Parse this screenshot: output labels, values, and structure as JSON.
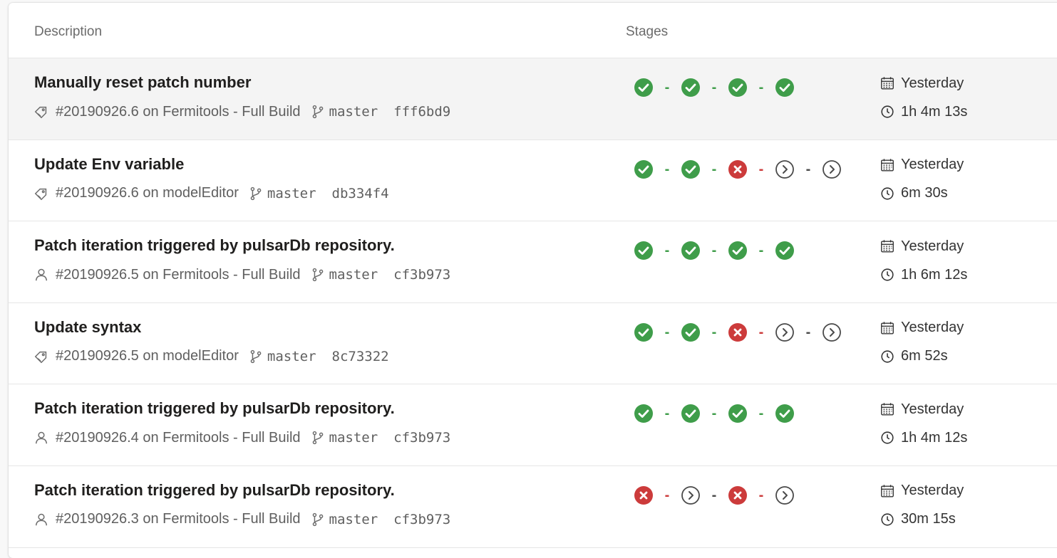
{
  "colors": {
    "success": "#3f9d4a",
    "failed": "#cc3b3b",
    "skipped": "#4a4a4a",
    "dash_success": "#3f9d4a",
    "dash_failed": "#cc3b3b",
    "dash_skipped": "#4a4a4a"
  },
  "header": {
    "description": "Description",
    "stages": "Stages"
  },
  "rows": [
    {
      "title": "Manually reset patch number",
      "trigger_icon": "tag-icon",
      "run_text": "#20190926.6 on Fermitools - Full Build",
      "branch": "master",
      "commit": "fff6bd9",
      "stages": [
        "success",
        "success",
        "success",
        "success"
      ],
      "date": "Yesterday",
      "duration": "1h 4m 13s",
      "selected": true
    },
    {
      "title": "Update Env variable",
      "trigger_icon": "tag-icon",
      "run_text": "#20190926.6 on modelEditor",
      "branch": "master",
      "commit": "db334f4",
      "stages": [
        "success",
        "success",
        "failed",
        "skipped",
        "skipped"
      ],
      "date": "Yesterday",
      "duration": "6m 30s",
      "selected": false
    },
    {
      "title": "Patch iteration triggered by pulsarDb repository.",
      "trigger_icon": "person-icon",
      "run_text": "#20190926.5 on Fermitools - Full Build",
      "branch": "master",
      "commit": "cf3b973",
      "stages": [
        "success",
        "success",
        "success",
        "success"
      ],
      "date": "Yesterday",
      "duration": "1h 6m 12s",
      "selected": false
    },
    {
      "title": "Update syntax",
      "trigger_icon": "tag-icon",
      "run_text": "#20190926.5 on modelEditor",
      "branch": "master",
      "commit": "8c73322",
      "stages": [
        "success",
        "success",
        "failed",
        "skipped",
        "skipped"
      ],
      "date": "Yesterday",
      "duration": "6m 52s",
      "selected": false
    },
    {
      "title": "Patch iteration triggered by pulsarDb repository.",
      "trigger_icon": "person-icon",
      "run_text": "#20190926.4 on Fermitools - Full Build",
      "branch": "master",
      "commit": "cf3b973",
      "stages": [
        "success",
        "success",
        "success",
        "success"
      ],
      "date": "Yesterday",
      "duration": "1h 4m 12s",
      "selected": false
    },
    {
      "title": "Patch iteration triggered by pulsarDb repository.",
      "trigger_icon": "person-icon",
      "run_text": "#20190926.3 on Fermitools - Full Build",
      "branch": "master",
      "commit": "cf3b973",
      "stages": [
        "failed",
        "skipped",
        "failed",
        "skipped"
      ],
      "date": "Yesterday",
      "duration": "30m 15s",
      "selected": false
    }
  ]
}
